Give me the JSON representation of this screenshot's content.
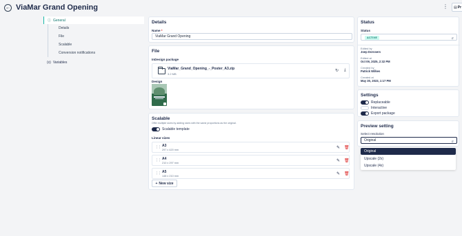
{
  "header": {
    "title": "ViaMar Grand Opening",
    "publish_label": "Pr"
  },
  "nav": {
    "items": [
      {
        "label": "General",
        "active": true
      },
      {
        "label": "Details"
      },
      {
        "label": "File"
      },
      {
        "label": "Scalable"
      },
      {
        "label": "Conversion notifications"
      }
    ],
    "variables": {
      "prefix": "(x)",
      "label": "Variables"
    }
  },
  "details": {
    "title": "Details",
    "name_label": "Name",
    "name_value": "ViaMar Grand Opening"
  },
  "file": {
    "title": "File",
    "package_label": "InDesign package",
    "file_name": "ViaMar_Grand_Opening_-_Poster_A3.zip",
    "file_size": "3.2 MB",
    "design_label": "Design"
  },
  "scalable": {
    "title": "Scalable",
    "description": "Offer multiple sizes by adding sizes with the same proportions as the original.",
    "template_label": "Scalable template",
    "linear_label": "Linear sizes",
    "sizes": [
      {
        "name": "A3",
        "dims": "297 x 420 mm"
      },
      {
        "name": "A4",
        "dims": "210 x 297 mm"
      },
      {
        "name": "A5",
        "dims": "148 x 210 mm"
      }
    ],
    "new_size_label": "New size"
  },
  "status": {
    "title": "Status",
    "label": "Status",
    "value": "ACTIVE",
    "meta": [
      {
        "key": "Edited by",
        "value": "Joep Dorssers"
      },
      {
        "key": "Edited at",
        "value": "Oct 09, 2025, 2:32 PM"
      },
      {
        "key": "Created by",
        "value": "Patrick Wilkes"
      },
      {
        "key": "Created at",
        "value": "May 30, 2023, 1:17 PM"
      }
    ]
  },
  "settings": {
    "title": "Settings",
    "items": [
      {
        "label": "Replaceable",
        "on": true
      },
      {
        "label": "Interactive",
        "on": false
      },
      {
        "label": "Export package",
        "on": true
      }
    ]
  },
  "preview": {
    "title": "Preview setting",
    "label": "Select resolution",
    "value": "Original",
    "options": [
      "Original",
      "Upscale (2x)",
      "Upscale (4x)"
    ]
  },
  "colors": {
    "primary": "#1e2a4a",
    "accent": "#14b8a6",
    "danger": "#dc2626"
  }
}
